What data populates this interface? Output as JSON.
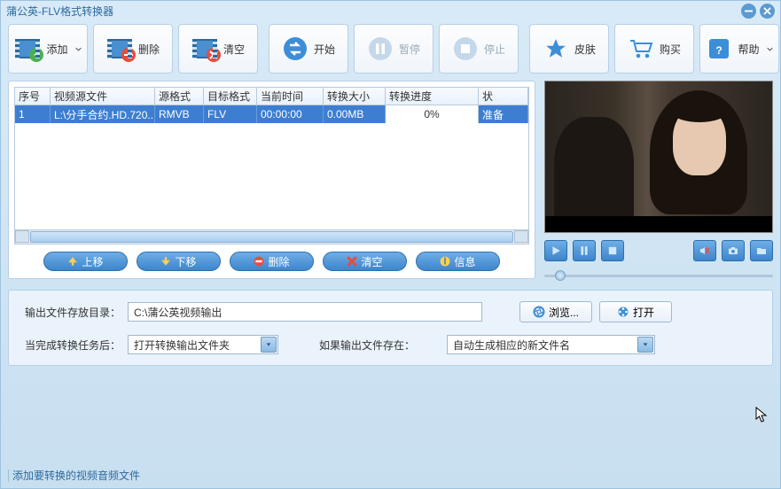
{
  "window": {
    "title": "蒲公英-FLV格式转换器"
  },
  "toolbar": {
    "add": "添加",
    "remove": "删除",
    "clear": "清空",
    "start": "开始",
    "pause": "暂停",
    "stop": "停止",
    "skin": "皮肤",
    "buy": "购买",
    "help": "帮助"
  },
  "table": {
    "headers": {
      "seq": "序号",
      "src": "视频源文件",
      "srcfmt": "源格式",
      "dstfmt": "目标格式",
      "time": "当前时间",
      "size": "转换大小",
      "progress": "转换进度",
      "status": "状"
    },
    "row": {
      "seq": "1",
      "src": "L:\\分手合约.HD.720...",
      "srcfmt": "RMVB",
      "dstfmt": "FLV",
      "time": "00:00:00",
      "size": "0.00MB",
      "progress": "0%",
      "status": "准备"
    }
  },
  "listActions": {
    "up": "上移",
    "down": "下移",
    "remove": "删除",
    "clear": "清空",
    "info": "信息"
  },
  "output": {
    "dir_label": "输出文件存放目录：",
    "dir_value": "C:\\蒲公英视频输出",
    "browse": "浏览...",
    "open": "打开",
    "after_label": "当完成转换任务后：",
    "after_value": "打开转换输出文件夹",
    "exists_label": "如果输出文件存在：",
    "exists_value": "自动生成相应的新文件名"
  },
  "status_hint": "添加要转换的视频音频文件"
}
